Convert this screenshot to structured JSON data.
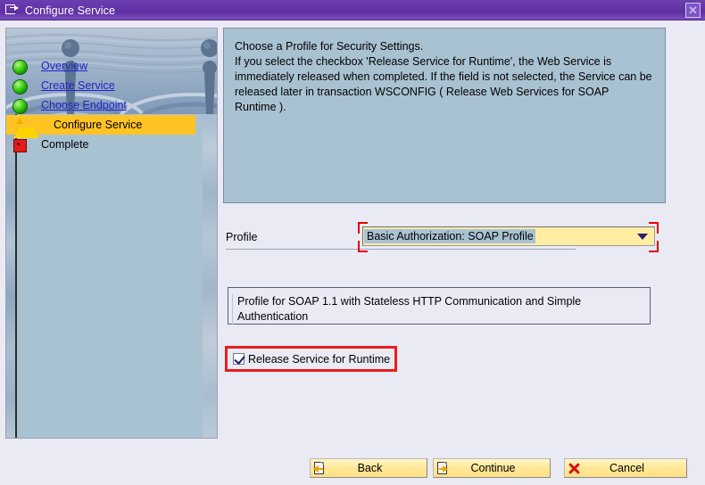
{
  "window": {
    "title": "Configure Service",
    "title_icon": "wizard-window-icon",
    "close_label": "✕"
  },
  "sidebar": {
    "banner_icon": "chess-pieces-ripple-banner",
    "steps": [
      {
        "label": "Overview",
        "state": "done",
        "icon": "green-sphere-icon"
      },
      {
        "label": "Create Service",
        "state": "done",
        "icon": "green-sphere-icon"
      },
      {
        "label": "Choose Endpoint",
        "state": "done",
        "icon": "green-sphere-icon"
      },
      {
        "label": "Configure Service",
        "state": "current",
        "icon": "yellow-triangle-icon"
      },
      {
        "label": "Complete",
        "state": "pending",
        "icon": "red-square-icon"
      }
    ]
  },
  "main": {
    "instruction_heading": "Choose a Profile for Security Settings.",
    "instruction_body": "If you select the checkbox 'Release Service for Runtime', the Web Service is immediately released when completed. If the field is not selected, the Service can be released later in transaction WSCONFIG ( Release Web Services for SOAP Runtime ).",
    "profile": {
      "label": "Profile",
      "selected_value": "Basic Authorization: SOAP Profile",
      "dropdown_icon": "chevron-down-icon",
      "highlight_color": "#e50000"
    },
    "description": "Profile for SOAP 1.1 with Stateless HTTP Communication and Simple Authentication",
    "release_checkbox": {
      "label": "Release Service for Runtime",
      "checked": true,
      "highlight_color": "#ec1c1c"
    }
  },
  "footer": {
    "buttons": [
      {
        "label": "Back",
        "icon": "page-back-arrow-icon"
      },
      {
        "label": "Continue",
        "icon": "page-forward-arrow-icon"
      },
      {
        "label": "Cancel",
        "icon": "red-x-icon"
      }
    ]
  },
  "colors": {
    "titlebar": "#6636ab",
    "panel_blue": "#a9c2d2",
    "form_bg": "#eaeaf5",
    "highlight_yellow": "#ffc423",
    "field_yellow": "#ffeda4",
    "link_blue": "#2222cc"
  }
}
